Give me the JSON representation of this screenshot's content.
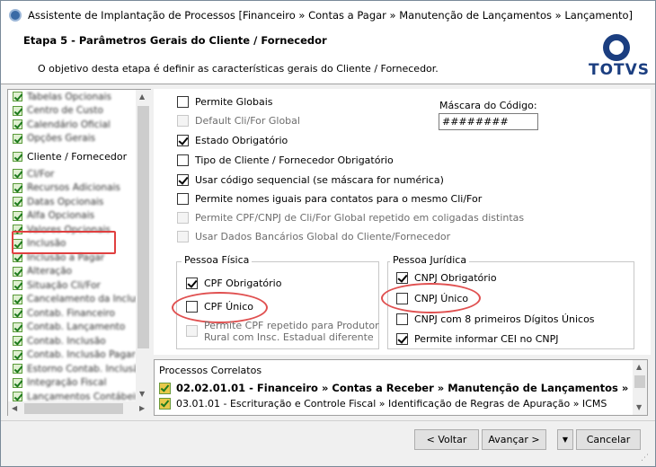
{
  "window": {
    "title": "Assistente de Implantação de Processos [Financeiro » Contas a Pagar » Manutenção de Lançamentos » Lançamento]"
  },
  "header": {
    "step_title": "Etapa 5 - Parâmetros Gerais do Cliente / Fornecedor",
    "step_description": "O objetivo desta etapa é definir as características gerais do Cliente / Fornecedor.",
    "logo_text": "TOTVS"
  },
  "sidebar": {
    "items": [
      {
        "label": "Tabelas Opcionais"
      },
      {
        "label": "Centro de Custo"
      },
      {
        "label": "Calendário Oficial"
      },
      {
        "label": "Opções Gerais"
      },
      {
        "label": "Cliente / Fornecedor"
      },
      {
        "label": "CI/For"
      },
      {
        "label": "Recursos Adicionais"
      },
      {
        "label": "Datas Opcionais"
      },
      {
        "label": "Alfa Opcionais"
      },
      {
        "label": "Valores Opcionais"
      },
      {
        "label": "Inclusão"
      },
      {
        "label": "Inclusão a Pagar"
      },
      {
        "label": "Alteração"
      },
      {
        "label": "Situação Cli/For"
      },
      {
        "label": "Cancelamento da Inclus"
      },
      {
        "label": "Contab. Financeiro"
      },
      {
        "label": "Contab. Lançamento"
      },
      {
        "label": "Contab. Inclusão"
      },
      {
        "label": "Contab. Inclusão Pagar"
      },
      {
        "label": "Estorno Contab. Inclusã"
      },
      {
        "label": "Integração Fiscal"
      },
      {
        "label": "Lançamentos Contábeis"
      }
    ],
    "active_index": 4
  },
  "options": {
    "permite_globais": {
      "label": "Permite Globais",
      "checked": false,
      "enabled": true
    },
    "default_global": {
      "label": "Default Cli/For Global",
      "checked": false,
      "enabled": false
    },
    "estado_obrigatorio": {
      "label": "Estado Obrigatório",
      "checked": true,
      "enabled": true
    },
    "tipo_obrigatorio": {
      "label": "Tipo de Cliente / Fornecedor Obrigatório",
      "checked": false,
      "enabled": true
    },
    "codigo_sequencial": {
      "label": "Usar código sequencial (se máscara for numérica)",
      "checked": true,
      "enabled": true
    },
    "nomes_iguais": {
      "label": "Permite nomes iguais para contatos para o mesmo Cli/For",
      "checked": false,
      "enabled": true
    },
    "cpf_cnpj_global": {
      "label": "Permite CPF/CNPJ de Cli/For Global repetido em coligadas distintas",
      "checked": false,
      "enabled": false
    },
    "dados_bancarios": {
      "label": "Usar Dados Bancários Global do Cliente/Fornecedor",
      "checked": false,
      "enabled": false
    }
  },
  "mask": {
    "label": "Máscara do Código:",
    "value": "########"
  },
  "pessoa_fisica": {
    "title": "Pessoa Física",
    "cpf_obrigatorio": {
      "label": "CPF Obrigatório",
      "checked": true
    },
    "cpf_unico": {
      "label": "CPF Único",
      "checked": false
    },
    "cpf_repetido": {
      "label_line1": "Permite CPF repetido para Produtor",
      "label_line2": "Rural com Insc. Estadual diferente",
      "checked": false,
      "enabled": false
    }
  },
  "pessoa_juridica": {
    "title": "Pessoa Jurídica",
    "cnpj_obrigatorio": {
      "label": "CNPJ Obrigatório",
      "checked": true
    },
    "cnpj_unico": {
      "label": "CNPJ Único",
      "checked": false
    },
    "cnpj_8_digitos": {
      "label": "CNPJ com 8 primeiros Dígitos Únicos",
      "checked": false
    },
    "cei_cnpj": {
      "label": "Permite informar CEI no CNPJ",
      "checked": true
    }
  },
  "processos": {
    "title": "Processos Correlatos",
    "items": [
      {
        "label": "02.02.01.01 - Financeiro » Contas a Receber » Manutenção de Lançamentos » Lançam…",
        "bold": true
      },
      {
        "label": "03.01.01 - Escrituração e Controle Fiscal » Identificação de Regras de Apuração » ICMS",
        "bold": false
      }
    ]
  },
  "buttons": {
    "back": "< Voltar",
    "next": "Avançar >",
    "dropdown_arrow": "▼",
    "cancel": "Cancelar"
  },
  "colors": {
    "highlight": "#e04040",
    "brand": "#1b3e80"
  }
}
